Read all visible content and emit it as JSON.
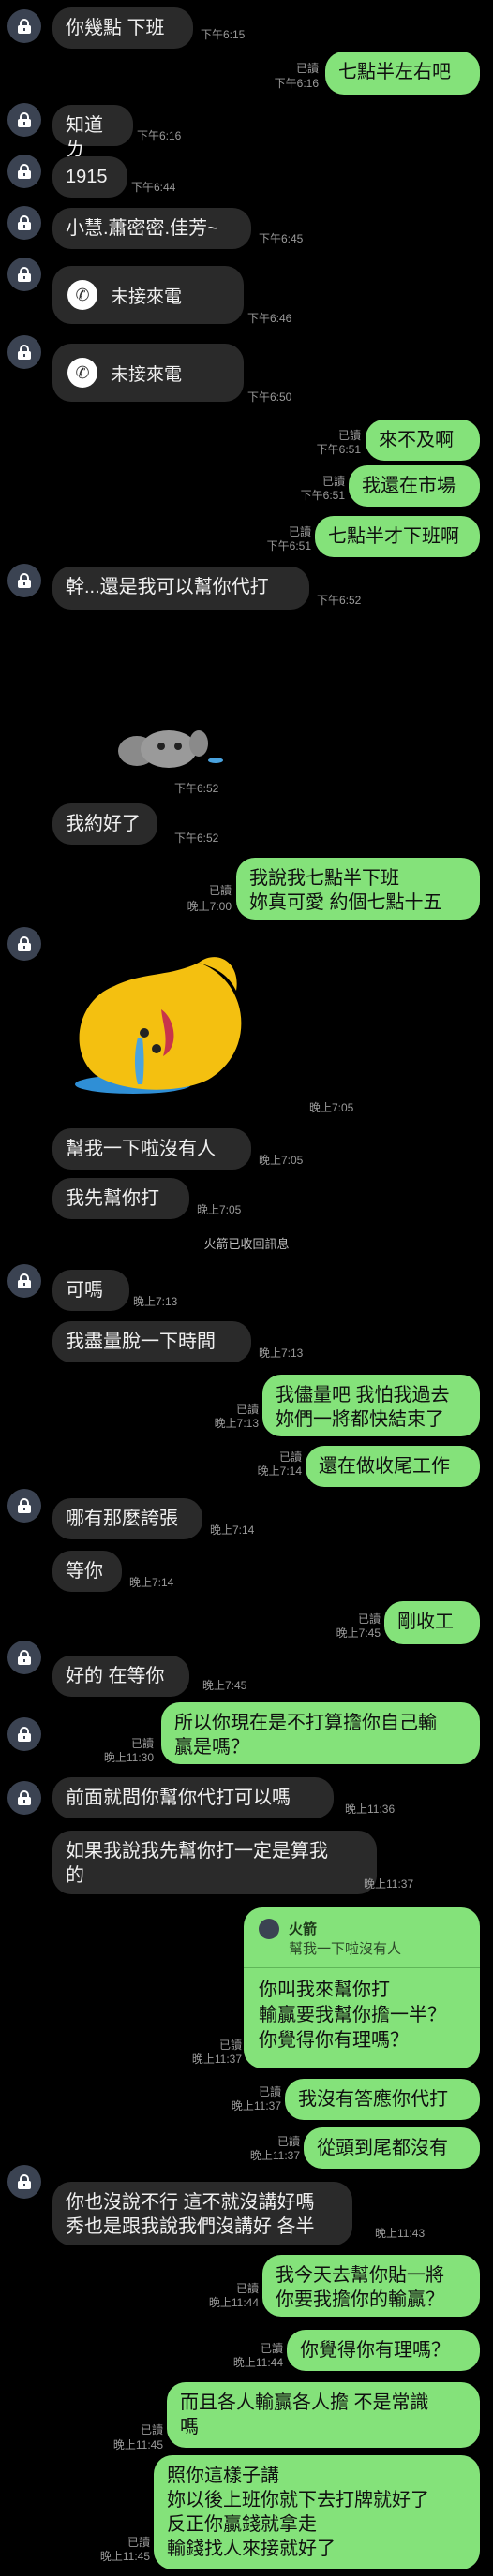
{
  "messages": {
    "m1": {
      "text": "你幾點 下班",
      "time": "下午6:15"
    },
    "m2": {
      "text": "七點半左右吧",
      "read": "已讀",
      "time": "下午6:16"
    },
    "m3": {
      "text": "知道ㄌ",
      "time": "下午6:16"
    },
    "m4": {
      "text": "1915",
      "time": "下午6:44"
    },
    "m5": {
      "text": "小慧.蕭密密.佳芳~",
      "time": "下午6:45"
    },
    "call1": {
      "text": "未接來電",
      "time": "下午6:46"
    },
    "call2": {
      "text": "未接來電",
      "time": "下午6:50"
    },
    "m6": {
      "text": "來不及啊",
      "read": "已讀",
      "time": "下午6:51"
    },
    "m7": {
      "text": "我還在市場",
      "read": "已讀",
      "time": "下午6:51"
    },
    "m8": {
      "text": "七點半才下班啊",
      "read": "已讀",
      "time": "下午6:51"
    },
    "m9": {
      "text": "幹...還是我可以幫你代打",
      "time": "下午6:52"
    },
    "sticker1": {
      "time": "下午6:52"
    },
    "m10": {
      "text": "我約好了",
      "time": "下午6:52"
    },
    "m11": {
      "text": "我說我七點半下班\n妳真可愛 約個七點十五",
      "read": "已讀",
      "time": "晚上7:00"
    },
    "sticker2": {
      "time": "晚上7:05"
    },
    "m12": {
      "text": "幫我一下啦沒有人",
      "time": "晚上7:05"
    },
    "m13": {
      "text": "我先幫你打",
      "time": "晚上7:05"
    },
    "notice": "火箭已收回訊息",
    "m14": {
      "text": "可嗎",
      "time": "晚上7:13"
    },
    "m15": {
      "text": "我盡量脫一下時間",
      "time": "晚上7:13"
    },
    "m16": {
      "text": "我儘量吧 我怕我過去\n妳們一將都快結束了",
      "read": "已讀",
      "time": "晚上7:13"
    },
    "m17": {
      "text": "還在做收尾工作",
      "read": "已讀",
      "time": "晚上7:14"
    },
    "m18": {
      "text": "哪有那麼誇張",
      "time": "晚上7:14"
    },
    "m19": {
      "text": "等你",
      "time": "晚上7:14"
    },
    "m20": {
      "text": "剛收工",
      "read": "已讀",
      "time": "晚上7:45"
    },
    "m21": {
      "text": "好的 在等你",
      "time": "晚上7:45"
    },
    "m22": {
      "text": "所以你現在是不打算擔你自己輸\n贏是嗎？",
      "read": "已讀",
      "time": "晚上11:30"
    },
    "m23": {
      "text": "前面就問你幫你代打可以嗎",
      "time": "晚上11:36"
    },
    "m24": {
      "text": "如果我說我先幫你打一定是算我\n的",
      "time": "晚上11:37"
    },
    "m25": {
      "quote_name": "火箭",
      "quote_text": "幫我一下啦沒有人",
      "text": "你叫我來幫你打\n輸贏要我幫你擔一半？\n你覺得你有理嗎？",
      "read": "已讀",
      "time": "晚上11:37"
    },
    "m26": {
      "text": "我沒有答應你代打",
      "read": "已讀",
      "time": "晚上11:37"
    },
    "m27": {
      "text": "從頭到尾都沒有",
      "read": "已讀",
      "time": "晚上11:37"
    },
    "m28": {
      "text": "你也沒說不行 這不就沒講好嗎\n秀也是跟我說我們沒講好 各半",
      "time": "晚上11:43"
    },
    "m29": {
      "text": "我今天去幫你貼一將\n你要我擔你的輸贏？",
      "read": "已讀",
      "time": "晚上11:44"
    },
    "m30": {
      "text": "你覺得你有理嗎？",
      "read": "已讀",
      "time": "晚上11:44"
    },
    "m31": {
      "text": "而且各人輸贏各人擔 不是常識\n嗎",
      "read": "已讀",
      "time": "晚上11:45"
    },
    "m32": {
      "text": "照你這樣子講\n妳以後上班你就下去打牌就好了\n反正你贏錢就拿走\n輸錢找人來接就好了",
      "read": "已讀",
      "time": "晚上11:45"
    }
  }
}
